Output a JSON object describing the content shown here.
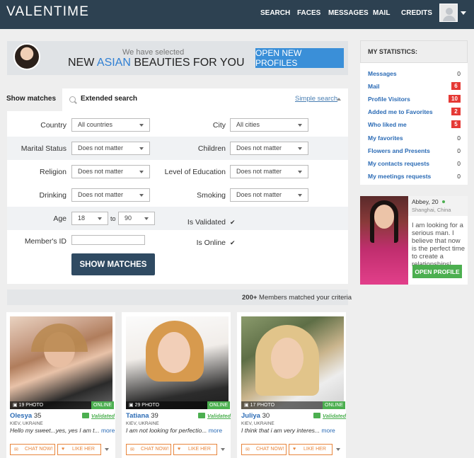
{
  "header": {
    "logo": "VALENTIME",
    "nav": [
      "SEARCH",
      "FACES",
      "MESSAGES",
      "MAIL",
      "CREDITS"
    ]
  },
  "banner": {
    "subtitle": "We have selected",
    "title_before": "NEW ",
    "title_accent": "ASIAN",
    "title_after": " BEAUTIES FOR YOU",
    "button": "OPEN NEW PROFILES"
  },
  "search": {
    "tab_show": "Show matches",
    "tab_extended": "Extended search",
    "simple_link": "Simple search",
    "fields": {
      "country": {
        "label": "Country",
        "value": "All countries"
      },
      "city": {
        "label": "City",
        "value": "All cities"
      },
      "marital": {
        "label": "Marital Status",
        "value": "Does not matter"
      },
      "children": {
        "label": "Children",
        "value": "Does not matter"
      },
      "religion": {
        "label": "Religion",
        "value": "Does not matter"
      },
      "education": {
        "label": "Level of Education",
        "value": "Does not matter"
      },
      "drinking": {
        "label": "Drinking",
        "value": "Does not matter"
      },
      "smoking": {
        "label": "Smoking",
        "value": "Does not matter"
      },
      "age": {
        "label": "Age",
        "from": "18",
        "to_label": "to",
        "to": "90"
      },
      "validated": {
        "label": "Is Validated",
        "checked": true
      },
      "member_id": {
        "label": "Member's ID",
        "value": ""
      },
      "online": {
        "label": "Is Online",
        "checked": true
      }
    },
    "submit": "SHOW MATCHES"
  },
  "results": {
    "count_strong": "200+",
    "count_text": " Members matched your criteria"
  },
  "cards": [
    {
      "photos": "19 PHOTO",
      "online": "ONLINE",
      "name": "Olesya",
      "age": "35",
      "validated": "Validated",
      "location": "KIEV, UKRAINE",
      "message": "Hello my sweet...yes, yes I am t...",
      "more": "more",
      "chat": "CHAT NOW!",
      "like": "LIKE HER"
    },
    {
      "photos": "29 PHOTO",
      "online": "ONLINE",
      "name": "Tatiana",
      "age": "39",
      "validated": "Validated",
      "location": "KIEV, UKRAINE",
      "message": "I am not looking for perfectio...",
      "more": "more",
      "chat": "CHAT NOW!",
      "like": "LIKE HER"
    },
    {
      "photos": "17 PHOTO",
      "online": "ONLINE",
      "name": "Juliya",
      "age": "30",
      "validated": "Validated",
      "location": "KIEV, UKRAINE",
      "message": "I think that i am very interes...",
      "more": "more",
      "chat": "CHAT NOW!",
      "like": "LIKE HER"
    }
  ],
  "stats": {
    "title": "MY STATISTICS:",
    "rows": [
      {
        "label": "Messages",
        "value": "0",
        "highlight": false
      },
      {
        "label": "Mail",
        "value": "6",
        "highlight": true
      },
      {
        "label": "Profile Visitors",
        "value": "10",
        "highlight": true
      },
      {
        "label": "Added me to Favorites",
        "value": "2",
        "highlight": true
      },
      {
        "label": "Who liked me",
        "value": "5",
        "highlight": true
      },
      {
        "label": "My favorites",
        "value": "0",
        "highlight": false
      },
      {
        "label": "Flowers and Presents",
        "value": "0",
        "highlight": false
      },
      {
        "label": "My contacts requests",
        "value": "0",
        "highlight": false
      },
      {
        "label": "My meetings requests",
        "value": "0",
        "highlight": false
      }
    ]
  },
  "featured": {
    "name": "Abbey, 20",
    "location": "Shanghai, China",
    "message": "I am looking for a serious man. I believe that now is the perfect time to create a relationships!",
    "button": "OPEN PROFILE"
  },
  "colors": {
    "header": "#2d4151",
    "accent_blue": "#3a8fd8",
    "link": "#2b6bb5",
    "online_green": "#4caf50",
    "badge_red": "#e53935",
    "button_orange": "#e8863d",
    "submit_dark": "#2f4a62"
  }
}
